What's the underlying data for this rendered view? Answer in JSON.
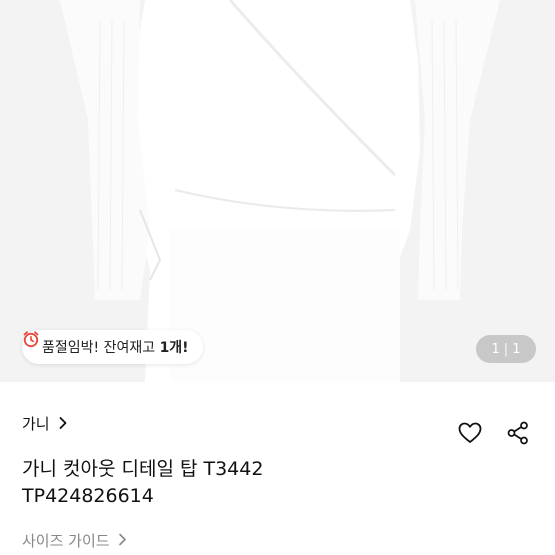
{
  "stock_notice": {
    "icon": "alarm-clock-icon",
    "prefix": "품절임박! 잔여재고 ",
    "count": "1개!"
  },
  "pager": {
    "current": "1",
    "separator": "|",
    "total": "1"
  },
  "brand": {
    "name": "가니",
    "icon": "chevron-right-icon"
  },
  "actions": {
    "like_icon": "heart-icon",
    "share_icon": "share-icon"
  },
  "product": {
    "title_line1": "가니 컷아웃 디테일 탑 T3442",
    "title_line2": "TP424826614"
  },
  "size_guide": {
    "label": "사이즈 가이드",
    "icon": "chevron-right-icon"
  },
  "colors": {
    "alarm_red": "#e8473b",
    "muted_text": "#888888",
    "image_bg": "#f4f4f4"
  }
}
